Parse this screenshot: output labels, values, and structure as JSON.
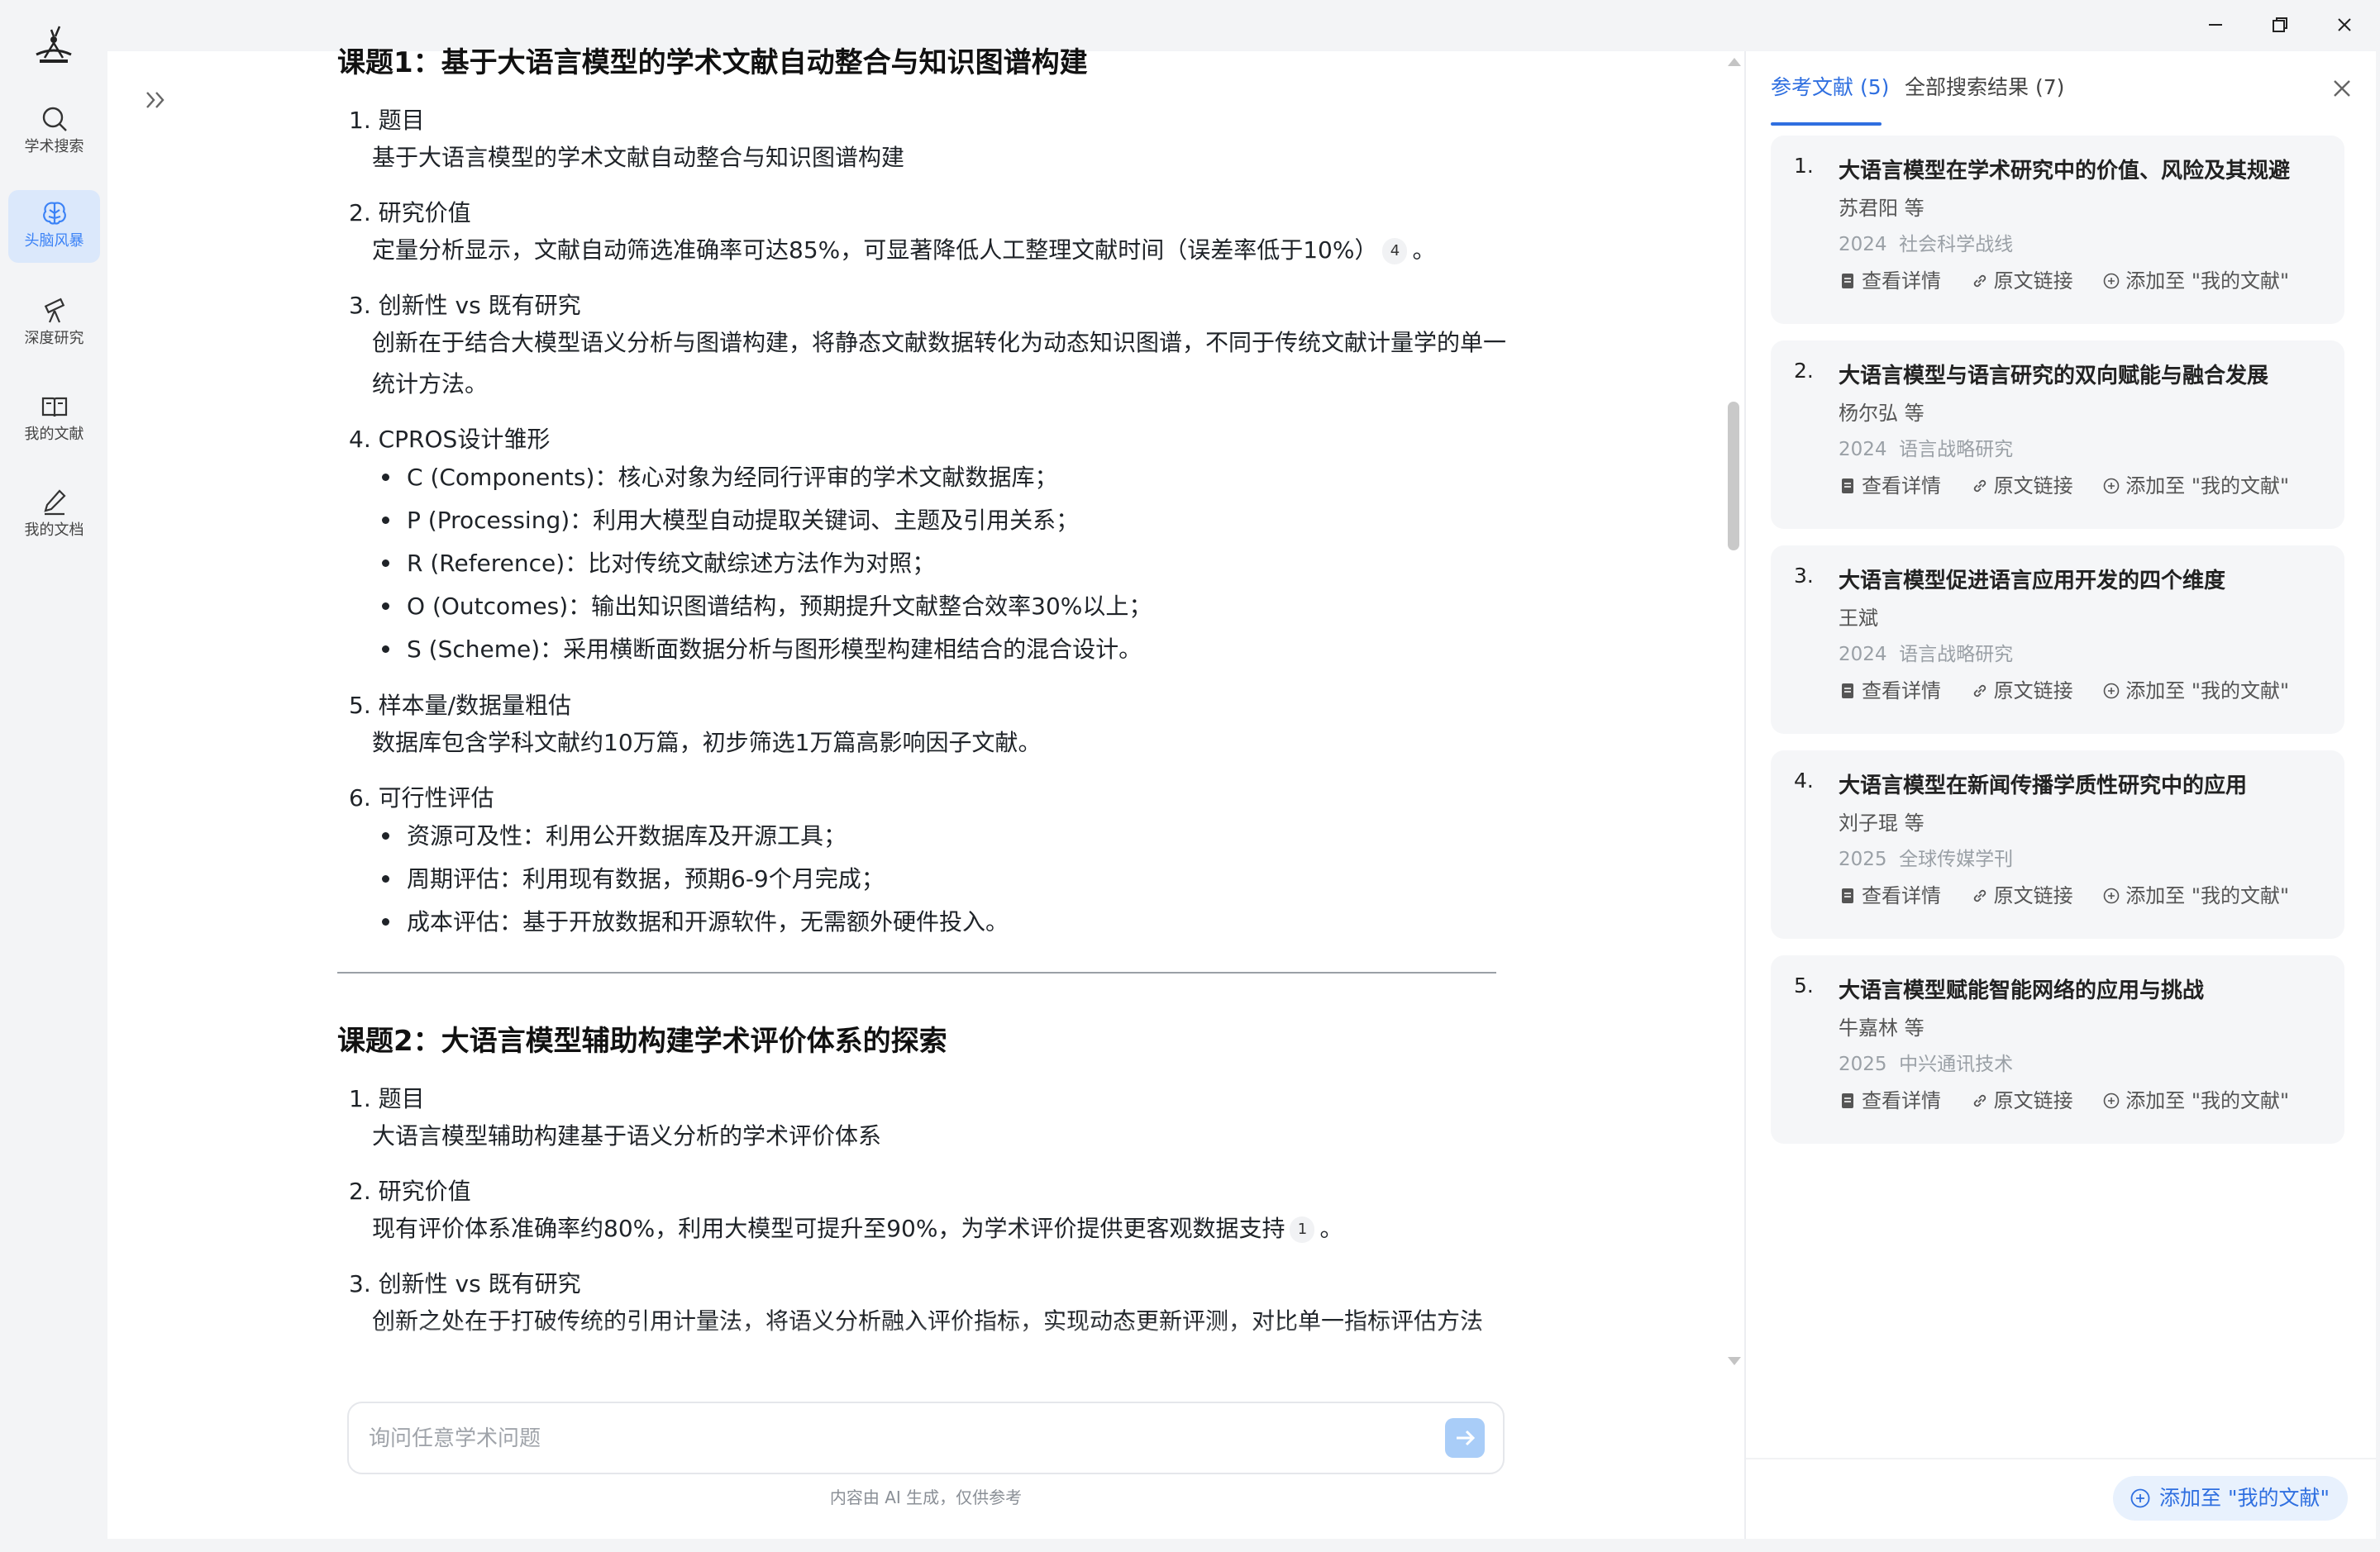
{
  "nav": {
    "items": [
      {
        "label": "学术搜索",
        "icon": "search-icon"
      },
      {
        "label": "头脑风暴",
        "icon": "brain-icon",
        "active": true
      },
      {
        "label": "深度研究",
        "icon": "telescope-icon"
      },
      {
        "label": "我的文献",
        "icon": "book-icon"
      },
      {
        "label": "我的文档",
        "icon": "pencil-icon"
      }
    ]
  },
  "main": {
    "topic1": {
      "title": "课题1：基于大语言模型的学术文献自动整合与知识图谱构建",
      "sections": [
        {
          "head": "1. 题目",
          "body": "基于大语言模型的学术文献自动整合与知识图谱构建"
        },
        {
          "head": "2. 研究价值",
          "body": "定量分析显示，文献自动筛选准确率可达85%，可显著降低人工整理文献时间（误差率低于10%）",
          "cite": "4",
          "tail": "。"
        },
        {
          "head": "3. 创新性 vs 既有研究",
          "body": "创新在于结合大模型语义分析与图谱构建，将静态文献数据转化为动态知识图谱，不同于传统文献计量学的单一统计方法。"
        },
        {
          "head": "4. CPROS设计雏形",
          "bullets": [
            "C (Components)：核心对象为经同行评审的学术文献数据库；",
            "P (Processing)：利用大模型自动提取关键词、主题及引用关系；",
            "R (Reference)：比对传统文献综述方法作为对照；",
            "O (Outcomes)：输出知识图谱结构，预期提升文献整合效率30%以上；",
            "S (Scheme)：采用横断面数据分析与图形模型构建相结合的混合设计。"
          ]
        },
        {
          "head": "5. 样本量/数据量粗估",
          "body": "数据库包含学科文献约10万篇，初步筛选1万篇高影响因子文献。"
        },
        {
          "head": "6. 可行性评估",
          "bullets": [
            "资源可及性：利用公开数据库及开源工具；",
            "周期评估：利用现有数据，预期6-9个月完成；",
            "成本评估：基于开放数据和开源软件，无需额外硬件投入。"
          ]
        }
      ]
    },
    "topic2": {
      "title": "课题2：大语言模型辅助构建学术评价体系的探索",
      "sections": [
        {
          "head": "1. 题目",
          "body": "大语言模型辅助构建基于语义分析的学术评价体系"
        },
        {
          "head": "2. 研究价值",
          "body": "现有评价体系准确率约80%，利用大模型可提升至90%，为学术评价提供更客观数据支持",
          "cite": "1",
          "tail": "。"
        },
        {
          "head": "3. 创新性 vs 既有研究",
          "body": "创新之处在于打破传统的引用计量法，将语义分析融入评价指标，实现动态更新评测，对比单一指标评估方法"
        }
      ]
    },
    "input": {
      "placeholder": "询问任意学术问题"
    },
    "disclaimer": "内容由 AI 生成，仅供参考"
  },
  "refs": {
    "tabs": [
      {
        "label": "参考文献 (5)",
        "active": true
      },
      {
        "label": "全部搜索结果 (7)",
        "active": false
      }
    ],
    "action_labels": {
      "detail": "查看详情",
      "link": "原文链接",
      "add": "添加至 \"我的文献\""
    },
    "items": [
      {
        "num": "1.",
        "title": "大语言模型在学术研究中的价值、风险及其规避",
        "author": "苏君阳 等",
        "year": "2024",
        "journal": "社会科学战线"
      },
      {
        "num": "2.",
        "title": "大语言模型与语言研究的双向赋能与融合发展",
        "author": "杨尔弘 等",
        "year": "2024",
        "journal": "语言战略研究"
      },
      {
        "num": "3.",
        "title": "大语言模型促进语言应用开发的四个维度",
        "author": "王斌",
        "year": "2024",
        "journal": "语言战略研究"
      },
      {
        "num": "4.",
        "title": "大语言模型在新闻传播学质性研究中的应用",
        "author": "刘子琨 等",
        "year": "2025",
        "journal": "全球传媒学刊"
      },
      {
        "num": "5.",
        "title": "大语言模型赋能智能网络的应用与挑战",
        "author": "牛嘉林 等",
        "year": "2025",
        "journal": "中兴通讯技术"
      }
    ],
    "add_all": "添加至 \"我的文献\""
  },
  "colors": {
    "accent": "#2f6fe0",
    "active_nav_bg": "#dbe8fb",
    "card_bg": "#f5f6f8"
  }
}
